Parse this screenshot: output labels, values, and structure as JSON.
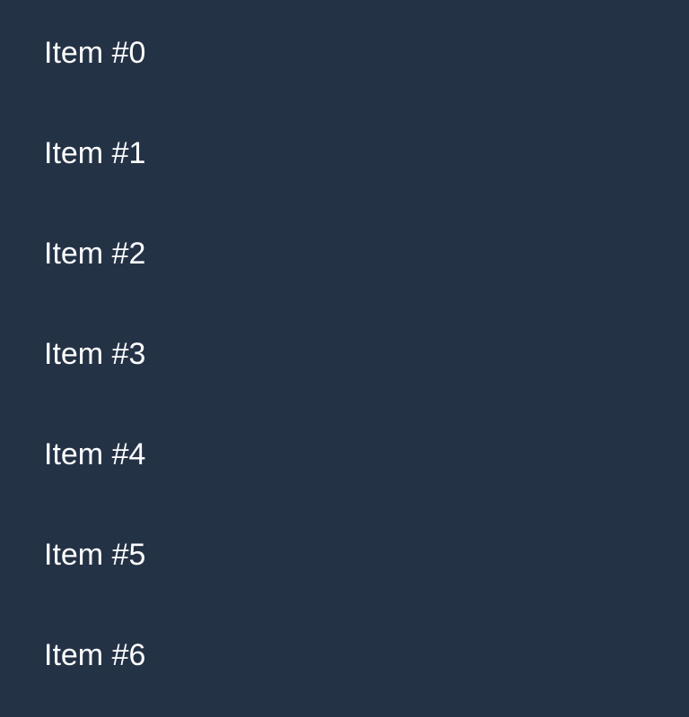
{
  "items": [
    {
      "label": "Item #0"
    },
    {
      "label": "Item #1"
    },
    {
      "label": "Item #2"
    },
    {
      "label": "Item #3"
    },
    {
      "label": "Item #4"
    },
    {
      "label": "Item #5"
    },
    {
      "label": "Item #6"
    }
  ],
  "colors": {
    "background": "#243246",
    "text": "#ffffff"
  }
}
